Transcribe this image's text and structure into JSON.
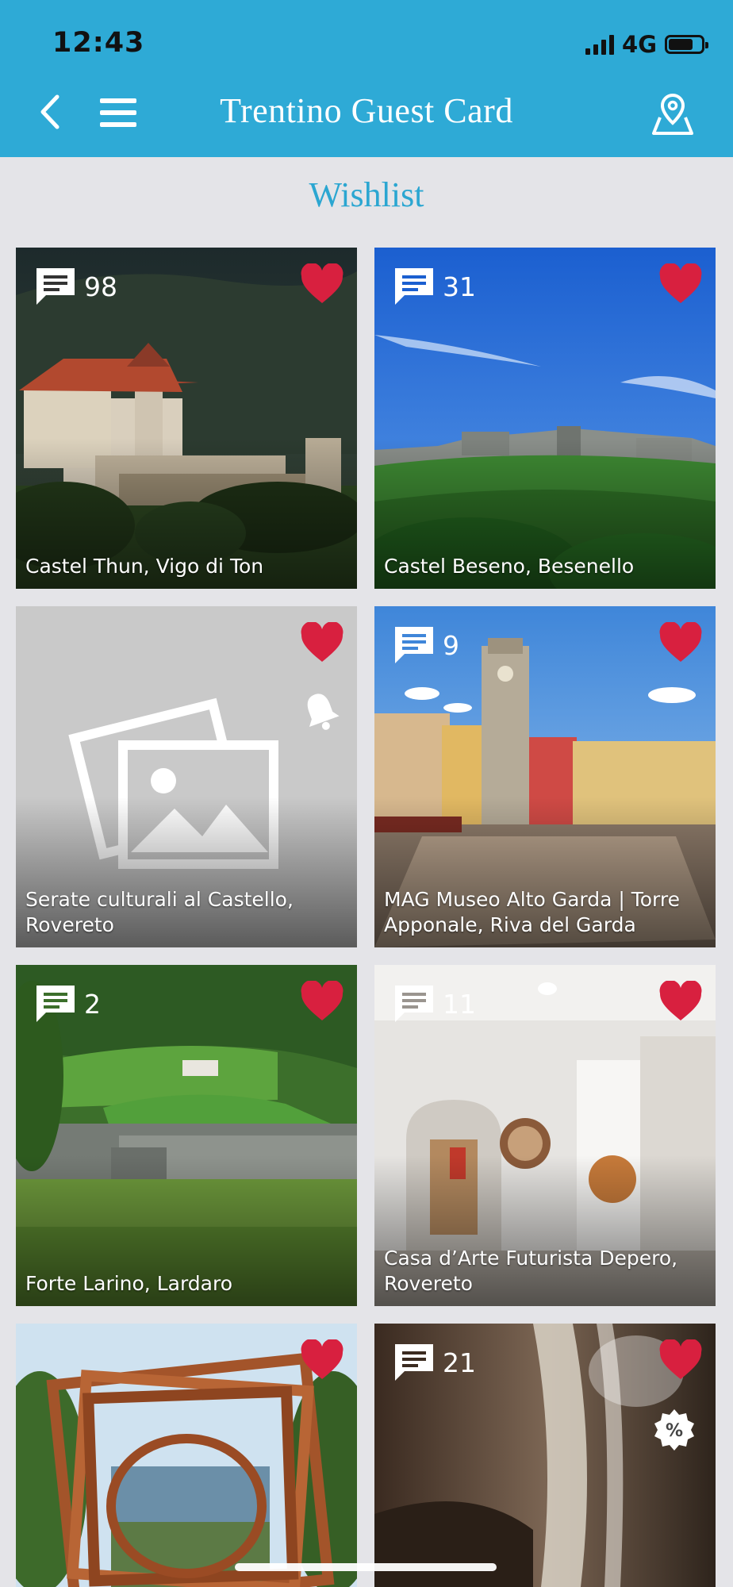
{
  "status": {
    "time": "12:43",
    "network": "4G"
  },
  "header": {
    "title": "Trentino Guest Card"
  },
  "page": {
    "title": "Wishlist"
  },
  "cards": [
    {
      "caption": "Castel Thun, Vigo di Ton",
      "comments": "98"
    },
    {
      "caption": "Castel Beseno, Besenello",
      "comments": "31"
    },
    {
      "caption": "Serate culturali al Castello, Rovereto",
      "comments": ""
    },
    {
      "caption": "MAG Museo Alto Garda | Torre Apponale, Riva del Garda",
      "comments": "9"
    },
    {
      "caption": "Forte Larino, Lardaro",
      "comments": "2"
    },
    {
      "caption": "Casa d’Arte Futurista Depero, Rovereto",
      "comments": "11"
    },
    {
      "caption": "",
      "comments": ""
    },
    {
      "caption": "",
      "comments": "21"
    }
  ],
  "colors": {
    "header_bg": "#2eaad6",
    "title_accent": "#2ba6d1",
    "heart": "#d8203f",
    "page_bg": "#e4e4e8"
  },
  "icons": [
    "back-icon",
    "menu-icon",
    "map-pin-icon",
    "comment-icon",
    "heart-icon",
    "bell-icon",
    "discount-badge-icon",
    "image-placeholder-icon"
  ]
}
